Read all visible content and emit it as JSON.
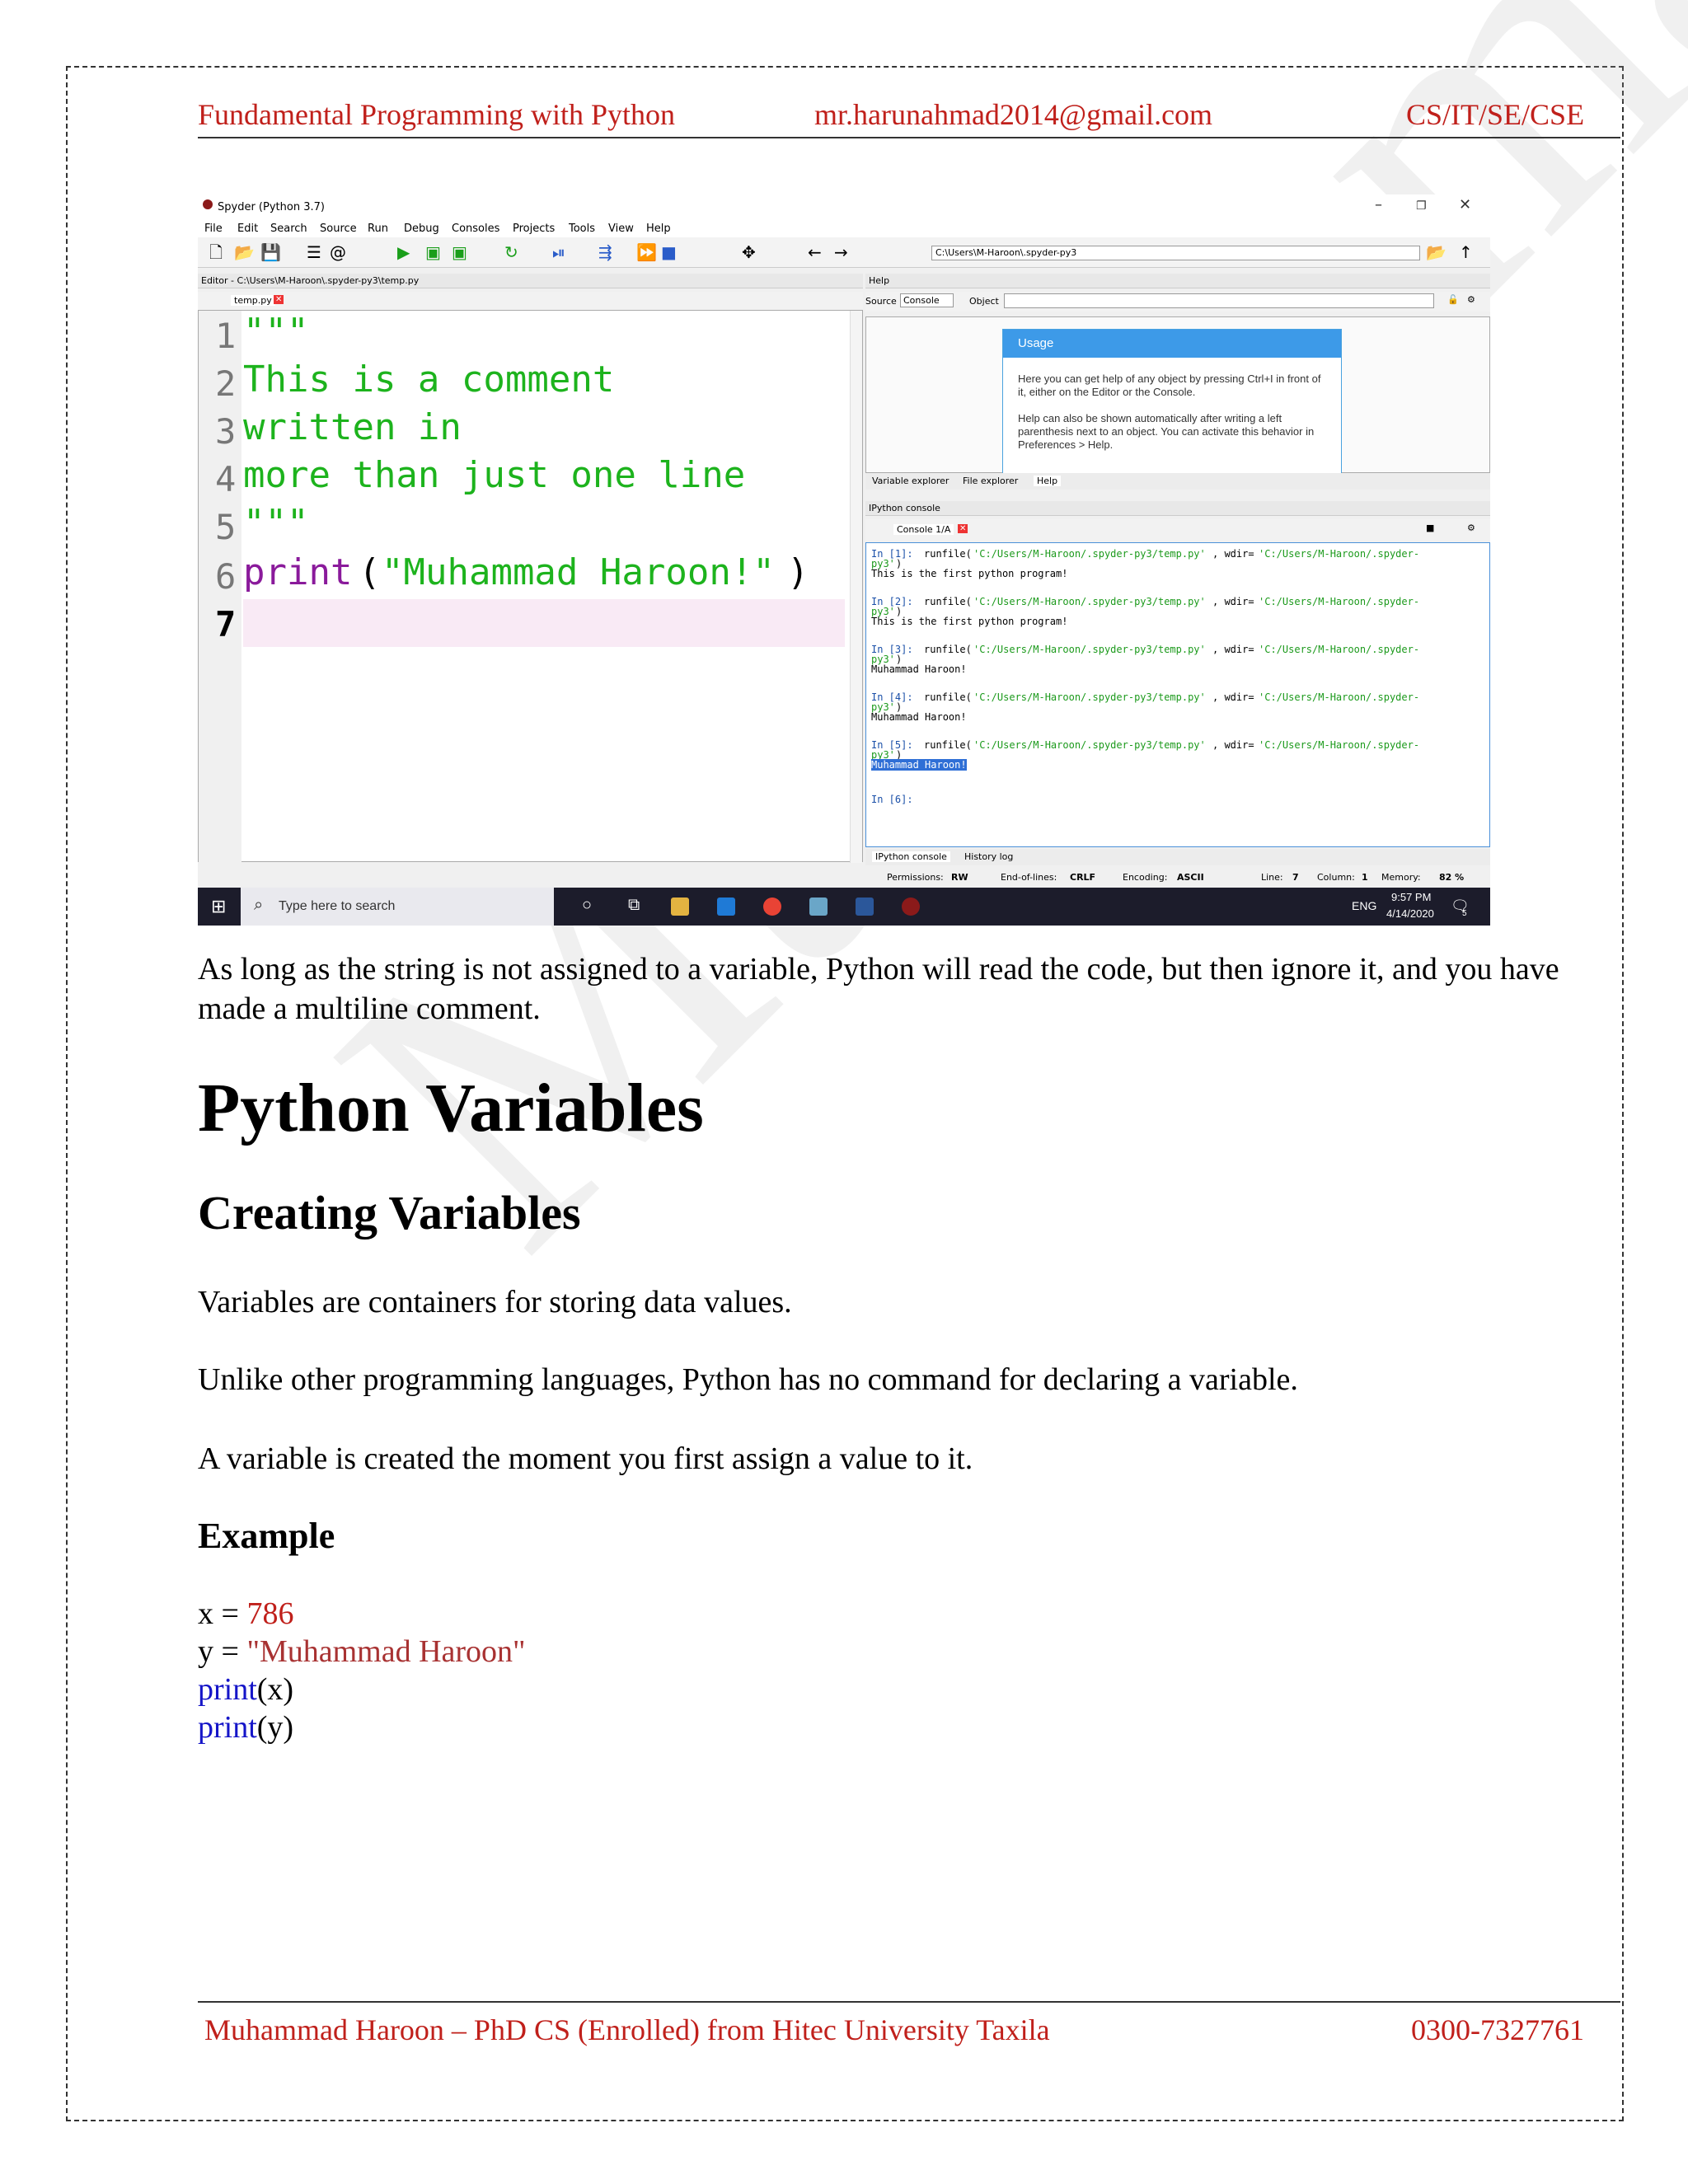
{
  "header": {
    "left": "Fundamental Programming with Python",
    "center": "mr.harunahmad2014@gmail.com",
    "right": "CS/IT/SE/CSE"
  },
  "footer": {
    "left": "Muhammad Haroon – PhD CS (Enrolled) from Hitec University Taxila",
    "right": "0300-7327761"
  },
  "watermark": "Muhammad Haroon",
  "spyder": {
    "window_title": "Spyder (Python 3.7)",
    "menu": [
      "File",
      "Edit",
      "Search",
      "Source",
      "Run",
      "Debug",
      "Consoles",
      "Projects",
      "Tools",
      "View",
      "Help"
    ],
    "path": "C:\\Users\\M-Haroon\\.spyder-py3",
    "editor_title": "Editor - C:\\Users\\M-Haroon\\.spyder-py3\\temp.py",
    "editor_tab": "temp.py",
    "line_numbers": [
      "1",
      "2",
      "3",
      "4",
      "5",
      "6",
      "7"
    ],
    "code_lines": [
      "\"\"\"",
      "This is a comment",
      "written in",
      "more than just one line",
      "\"\"\""
    ],
    "print_kw": "print",
    "print_open": "(",
    "print_str": "\"Muhammad Haroon!\"",
    "print_close": ")",
    "help_title": "Help",
    "help_source_label": "Source",
    "help_source_value": "Console",
    "help_object_label": "Object",
    "usage_title": "Usage",
    "usage_p1": "Here you can get help of any object by pressing Ctrl+I in front of it, either on the Editor or the Console.",
    "usage_p2": "Help can also be shown automatically after writing a left parenthesis next to an object. You can activate this behavior in Preferences > Help.",
    "help_tabs": [
      "Variable explorer",
      "File explorer",
      "Help"
    ],
    "console_title": "IPython console",
    "console_tab": "Console 1/A",
    "console_lines": [
      {
        "prompt": "In [1]: ",
        "cmd": "runfile(",
        "arg": "'C:/Users/M-Haroon/.spyder-py3/temp.py'",
        "mid": ", wdir=",
        "arg2": "'C:/Users/M-Haroon/.spyder-",
        "cont": "py3'",
        "close": ")",
        "out": "This is the first python program!"
      },
      {
        "prompt": "In [2]: ",
        "cmd": "runfile(",
        "arg": "'C:/Users/M-Haroon/.spyder-py3/temp.py'",
        "mid": ", wdir=",
        "arg2": "'C:/Users/M-Haroon/.spyder-",
        "cont": "py3'",
        "close": ")",
        "out": "This is the first python program!"
      },
      {
        "prompt": "In [3]: ",
        "cmd": "runfile(",
        "arg": "'C:/Users/M-Haroon/.spyder-py3/temp.py'",
        "mid": ", wdir=",
        "arg2": "'C:/Users/M-Haroon/.spyder-",
        "cont": "py3'",
        "close": ")",
        "out": "Muhammad Haroon!"
      },
      {
        "prompt": "In [4]: ",
        "cmd": "runfile(",
        "arg": "'C:/Users/M-Haroon/.spyder-py3/temp.py'",
        "mid": ", wdir=",
        "arg2": "'C:/Users/M-Haroon/.spyder-",
        "cont": "py3'",
        "close": ")",
        "out": "Muhammad Haroon!"
      },
      {
        "prompt": "In [5]: ",
        "cmd": "runfile(",
        "arg": "'C:/Users/M-Haroon/.spyder-py3/temp.py'",
        "mid": ", wdir=",
        "arg2": "'C:/Users/M-Haroon/.spyder-",
        "cont": "py3'",
        "close": ")",
        "out": "Muhammad Haroon!"
      }
    ],
    "console_prompt": "In [6]:",
    "console_tabs": [
      "IPython console",
      "History log"
    ],
    "status": {
      "permissions_label": "Permissions:",
      "permissions": "RW",
      "eol_label": "End-of-lines:",
      "eol": "CRLF",
      "encoding_label": "Encoding:",
      "encoding": "ASCII",
      "line_label": "Line:",
      "line": "7",
      "column_label": "Column:",
      "column": "1",
      "memory_label": "Memory:",
      "memory": "82 %"
    }
  },
  "taskbar": {
    "search_placeholder": "Type here to search",
    "lang": "ENG",
    "time": "9:57 PM",
    "date": "4/14/2020",
    "notif_count": "5"
  },
  "body": {
    "intro": "As long as the string is not assigned to a variable, Python will read the code, but then ignore it, and you have made a multiline comment.",
    "h1": "Python Variables",
    "h2": "Creating Variables",
    "p1": "Variables are containers for storing data values.",
    "p2": "Unlike other programming languages, Python has no command for declaring a variable.",
    "p3": "A variable is created the moment you first assign a value to it.",
    "example_heading": "Example",
    "ex_x_lhs": "x = ",
    "ex_x_val": "786",
    "ex_y_lhs": "y = ",
    "ex_y_val": "\"Muhammad Haroon\"",
    "ex_print": "print",
    "ex_print1_arg": "(x)",
    "ex_print2_arg": "(y)"
  }
}
